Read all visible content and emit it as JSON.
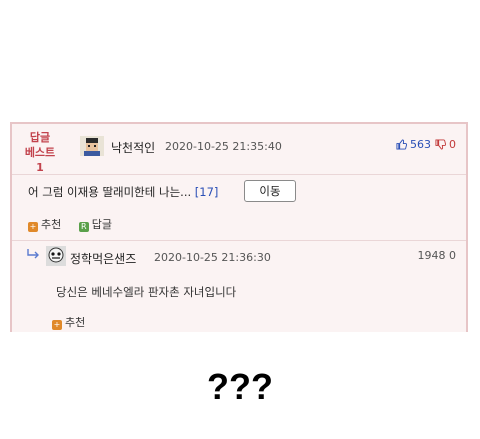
{
  "best_comment": {
    "badge_line1": "답글",
    "badge_line2": "베스트1",
    "username": "낙천적인",
    "timestamp": "2020-10-25 21:35:40",
    "upvotes": "563",
    "downvotes": "0",
    "text": "어 그럼 이재용 딸래미한테 나는...",
    "reply_count": "[17]",
    "move_button": "이동",
    "recommend_label": "추천",
    "reply_label": "답글",
    "reply_chip": "R",
    "colors": {
      "accent": "#c2434d",
      "border": "#e7c5c7",
      "background": "#fbf3f3"
    }
  },
  "reply_comment": {
    "username": "정학먹은샌즈",
    "timestamp": "2020-10-25 21:36:30",
    "score": "1948 0",
    "text": "당신은 베네수엘라 판자촌 자녀입니다",
    "recommend_label": "추천"
  },
  "caption": "???",
  "icons": [
    "thumbs-up-icon",
    "thumbs-down-icon",
    "reply-arrow-icon",
    "recommend-icon",
    "reply-icon",
    "avatar-icon"
  ]
}
